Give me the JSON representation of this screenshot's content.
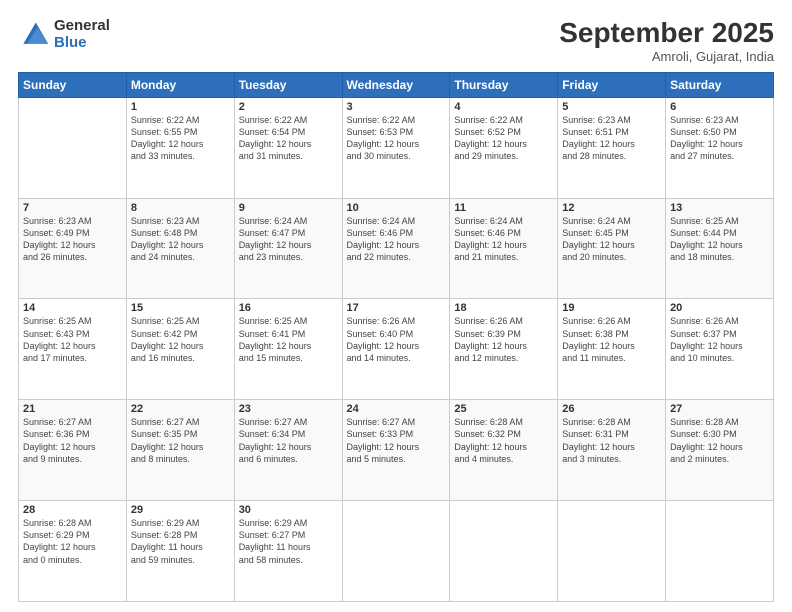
{
  "header": {
    "logo_general": "General",
    "logo_blue": "Blue",
    "title": "September 2025",
    "subtitle": "Amroli, Gujarat, India"
  },
  "columns": [
    "Sunday",
    "Monday",
    "Tuesday",
    "Wednesday",
    "Thursday",
    "Friday",
    "Saturday"
  ],
  "weeks": [
    [
      {
        "day": "",
        "info": ""
      },
      {
        "day": "1",
        "info": "Sunrise: 6:22 AM\nSunset: 6:55 PM\nDaylight: 12 hours\nand 33 minutes."
      },
      {
        "day": "2",
        "info": "Sunrise: 6:22 AM\nSunset: 6:54 PM\nDaylight: 12 hours\nand 31 minutes."
      },
      {
        "day": "3",
        "info": "Sunrise: 6:22 AM\nSunset: 6:53 PM\nDaylight: 12 hours\nand 30 minutes."
      },
      {
        "day": "4",
        "info": "Sunrise: 6:22 AM\nSunset: 6:52 PM\nDaylight: 12 hours\nand 29 minutes."
      },
      {
        "day": "5",
        "info": "Sunrise: 6:23 AM\nSunset: 6:51 PM\nDaylight: 12 hours\nand 28 minutes."
      },
      {
        "day": "6",
        "info": "Sunrise: 6:23 AM\nSunset: 6:50 PM\nDaylight: 12 hours\nand 27 minutes."
      }
    ],
    [
      {
        "day": "7",
        "info": "Sunrise: 6:23 AM\nSunset: 6:49 PM\nDaylight: 12 hours\nand 26 minutes."
      },
      {
        "day": "8",
        "info": "Sunrise: 6:23 AM\nSunset: 6:48 PM\nDaylight: 12 hours\nand 24 minutes."
      },
      {
        "day": "9",
        "info": "Sunrise: 6:24 AM\nSunset: 6:47 PM\nDaylight: 12 hours\nand 23 minutes."
      },
      {
        "day": "10",
        "info": "Sunrise: 6:24 AM\nSunset: 6:46 PM\nDaylight: 12 hours\nand 22 minutes."
      },
      {
        "day": "11",
        "info": "Sunrise: 6:24 AM\nSunset: 6:46 PM\nDaylight: 12 hours\nand 21 minutes."
      },
      {
        "day": "12",
        "info": "Sunrise: 6:24 AM\nSunset: 6:45 PM\nDaylight: 12 hours\nand 20 minutes."
      },
      {
        "day": "13",
        "info": "Sunrise: 6:25 AM\nSunset: 6:44 PM\nDaylight: 12 hours\nand 18 minutes."
      }
    ],
    [
      {
        "day": "14",
        "info": "Sunrise: 6:25 AM\nSunset: 6:43 PM\nDaylight: 12 hours\nand 17 minutes."
      },
      {
        "day": "15",
        "info": "Sunrise: 6:25 AM\nSunset: 6:42 PM\nDaylight: 12 hours\nand 16 minutes."
      },
      {
        "day": "16",
        "info": "Sunrise: 6:25 AM\nSunset: 6:41 PM\nDaylight: 12 hours\nand 15 minutes."
      },
      {
        "day": "17",
        "info": "Sunrise: 6:26 AM\nSunset: 6:40 PM\nDaylight: 12 hours\nand 14 minutes."
      },
      {
        "day": "18",
        "info": "Sunrise: 6:26 AM\nSunset: 6:39 PM\nDaylight: 12 hours\nand 12 minutes."
      },
      {
        "day": "19",
        "info": "Sunrise: 6:26 AM\nSunset: 6:38 PM\nDaylight: 12 hours\nand 11 minutes."
      },
      {
        "day": "20",
        "info": "Sunrise: 6:26 AM\nSunset: 6:37 PM\nDaylight: 12 hours\nand 10 minutes."
      }
    ],
    [
      {
        "day": "21",
        "info": "Sunrise: 6:27 AM\nSunset: 6:36 PM\nDaylight: 12 hours\nand 9 minutes."
      },
      {
        "day": "22",
        "info": "Sunrise: 6:27 AM\nSunset: 6:35 PM\nDaylight: 12 hours\nand 8 minutes."
      },
      {
        "day": "23",
        "info": "Sunrise: 6:27 AM\nSunset: 6:34 PM\nDaylight: 12 hours\nand 6 minutes."
      },
      {
        "day": "24",
        "info": "Sunrise: 6:27 AM\nSunset: 6:33 PM\nDaylight: 12 hours\nand 5 minutes."
      },
      {
        "day": "25",
        "info": "Sunrise: 6:28 AM\nSunset: 6:32 PM\nDaylight: 12 hours\nand 4 minutes."
      },
      {
        "day": "26",
        "info": "Sunrise: 6:28 AM\nSunset: 6:31 PM\nDaylight: 12 hours\nand 3 minutes."
      },
      {
        "day": "27",
        "info": "Sunrise: 6:28 AM\nSunset: 6:30 PM\nDaylight: 12 hours\nand 2 minutes."
      }
    ],
    [
      {
        "day": "28",
        "info": "Sunrise: 6:28 AM\nSunset: 6:29 PM\nDaylight: 12 hours\nand 0 minutes."
      },
      {
        "day": "29",
        "info": "Sunrise: 6:29 AM\nSunset: 6:28 PM\nDaylight: 11 hours\nand 59 minutes."
      },
      {
        "day": "30",
        "info": "Sunrise: 6:29 AM\nSunset: 6:27 PM\nDaylight: 11 hours\nand 58 minutes."
      },
      {
        "day": "",
        "info": ""
      },
      {
        "day": "",
        "info": ""
      },
      {
        "day": "",
        "info": ""
      },
      {
        "day": "",
        "info": ""
      }
    ]
  ]
}
